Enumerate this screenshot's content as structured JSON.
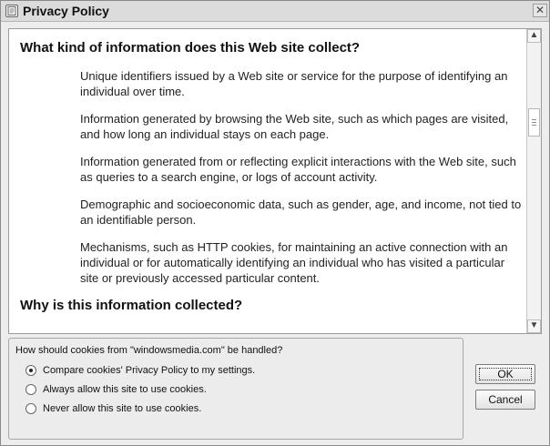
{
  "window": {
    "title": "Privacy Policy",
    "close_label": "✕",
    "icon": "privacy-icon"
  },
  "content": {
    "heading1": "What kind of information does this Web site collect?",
    "items": [
      "Unique identifiers issued by a Web site or service for the purpose of identifying an individual over time.",
      "Information generated by browsing the Web site, such as which pages are visited, and how long an individual stays on each page.",
      "Information generated from or reflecting explicit interactions with the Web site, such as queries to a search engine, or logs of account activity.",
      "Demographic and socioeconomic data, such as gender, age, and income, not tied to an identifiable person.",
      "Mechanisms, such as HTTP cookies, for maintaining an active connection with an individual or for automatically identifying an individual who has visited a particular site or previously accessed particular content."
    ],
    "heading2": "Why is this information collected?"
  },
  "cookie_prompt": {
    "question": "How should cookies from \"windowsmedia.com\" be handled?",
    "options": [
      "Compare cookies' Privacy Policy to my settings.",
      "Always allow this site to use cookies.",
      "Never allow this site to use cookies."
    ],
    "selected_index": 0
  },
  "buttons": {
    "ok": "OK",
    "cancel": "Cancel"
  },
  "scrollbar": {
    "up_icon": "▲",
    "down_icon": "▼",
    "position_percent": 26
  },
  "colors": {
    "window_bg": "#ededed",
    "content_bg": "#ffffff",
    "border": "#9c9c9c"
  }
}
